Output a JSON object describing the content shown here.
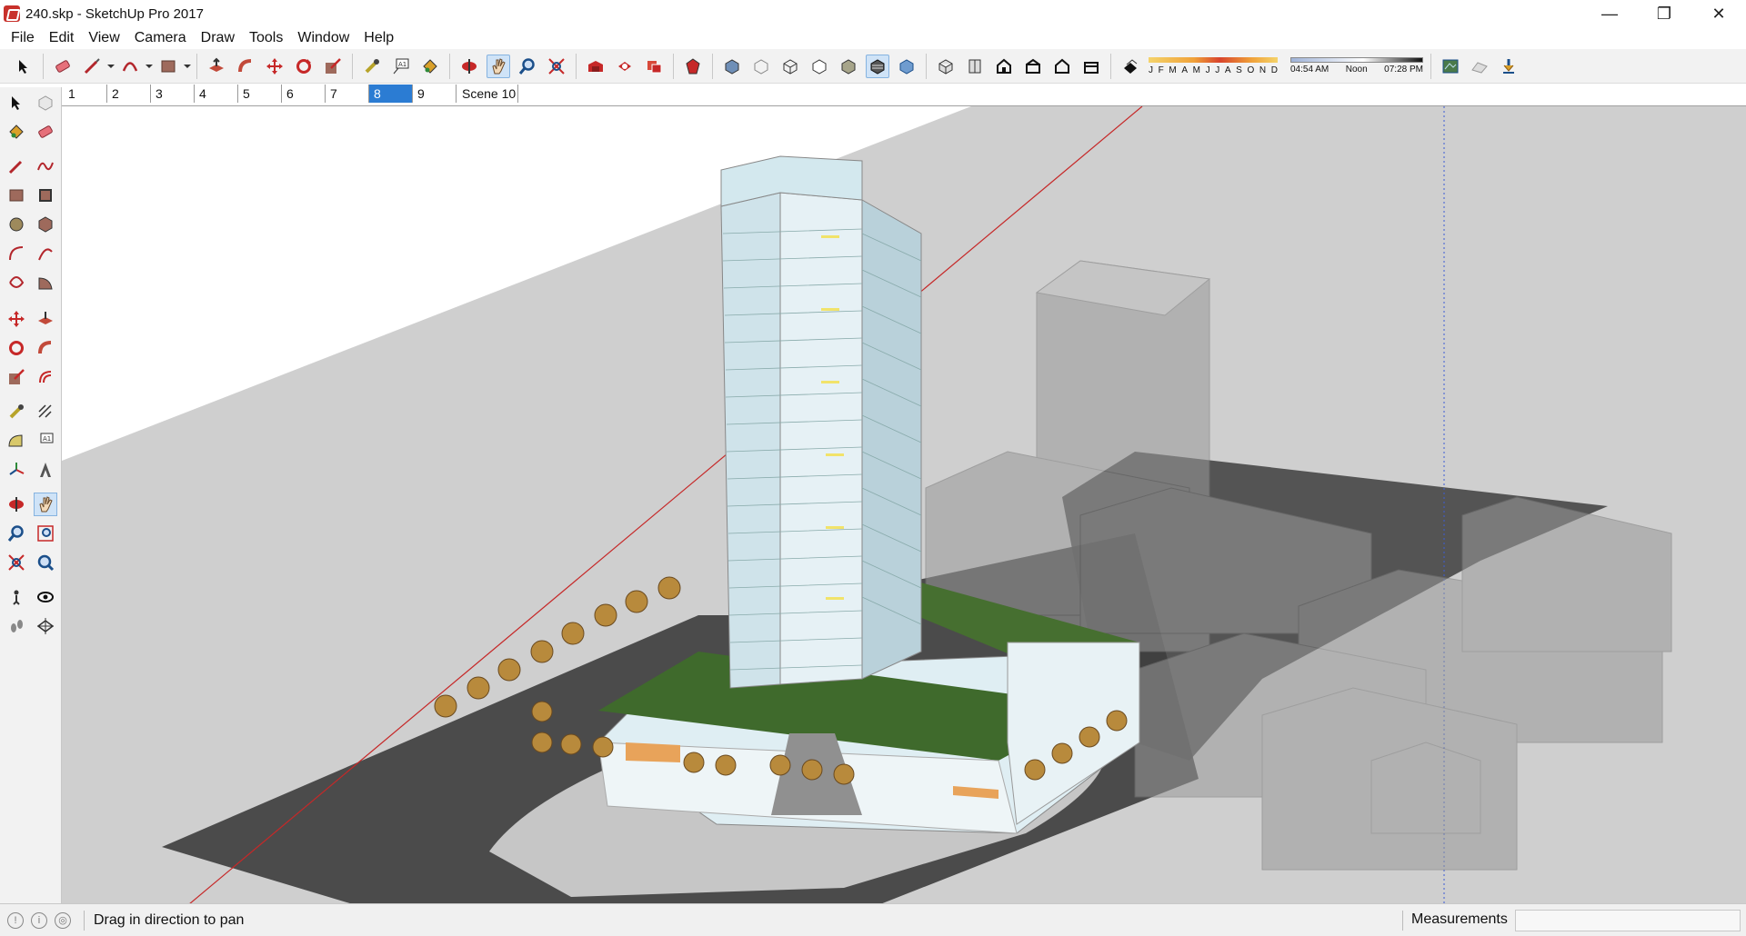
{
  "window": {
    "title": "240.skp - SketchUp Pro 2017",
    "minimize_glyph": "—",
    "restore_glyph": "❐",
    "close_glyph": "✕"
  },
  "menu": [
    "File",
    "Edit",
    "View",
    "Camera",
    "Draw",
    "Tools",
    "Window",
    "Help"
  ],
  "shadow_settings": {
    "months": [
      "J",
      "F",
      "M",
      "A",
      "M",
      "J",
      "J",
      "A",
      "S",
      "O",
      "N",
      "D"
    ],
    "time_start": "04:54 AM",
    "time_mid": "Noon",
    "time_end": "07:28 PM"
  },
  "scenes": {
    "tabs": [
      "1",
      "2",
      "3",
      "4",
      "5",
      "6",
      "7",
      "8",
      "9",
      "Scene 10"
    ],
    "active": "8"
  },
  "status": {
    "hint": "Drag in direction to pan",
    "measurements_label": "Measurements",
    "measurements_value": ""
  },
  "active_tool": "pan",
  "colors": {
    "accent": "#2b7cd3",
    "ground": "#cdcdcd",
    "road": "#4a4a4a",
    "roof": "#3f6a2c",
    "glass": "#cfe6ec",
    "axis_red": "#c62828",
    "axis_blue": "#3b5bd6"
  }
}
